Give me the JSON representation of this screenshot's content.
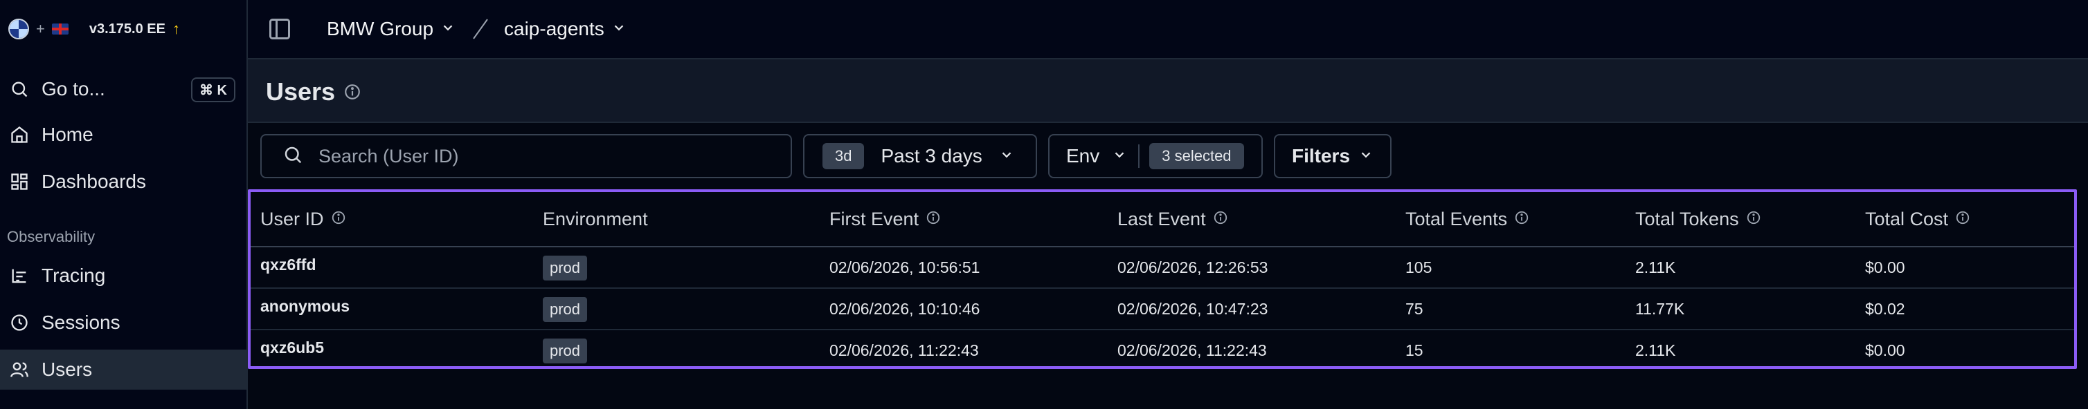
{
  "app": {
    "version": "v3.175.0 EE",
    "plus": "+"
  },
  "sidebar": {
    "goto": {
      "label": "Go to...",
      "shortcut": "⌘ K"
    },
    "items": [
      {
        "label": "Home",
        "icon": "home-icon"
      },
      {
        "label": "Dashboards",
        "icon": "dashboard-icon"
      }
    ],
    "section_label": "Observability",
    "observability_items": [
      {
        "label": "Tracing",
        "icon": "tracing-icon"
      },
      {
        "label": "Sessions",
        "icon": "sessions-icon"
      },
      {
        "label": "Users",
        "icon": "users-icon",
        "active": true
      }
    ]
  },
  "topbar": {
    "organization": "BMW Group",
    "project": "caip-agents"
  },
  "page": {
    "title": "Users"
  },
  "toolbar": {
    "search_placeholder": "Search (User ID)",
    "date_pill": "3d",
    "date_label": "Past 3 days",
    "env_label": "Env",
    "env_selected": "3 selected",
    "filters_label": "Filters"
  },
  "table": {
    "columns": [
      "User ID",
      "Environment",
      "First Event",
      "Last Event",
      "Total Events",
      "Total Tokens",
      "Total Cost"
    ],
    "rows": [
      {
        "user_id": "qxz6ffd",
        "environment": "prod",
        "first_event": "02/06/2026, 10:56:51",
        "last_event": "02/06/2026, 12:26:53",
        "total_events": "105",
        "total_tokens": "2.11K",
        "total_cost": "$0.00"
      },
      {
        "user_id": "anonymous",
        "environment": "prod",
        "first_event": "02/06/2026, 10:10:46",
        "last_event": "02/06/2026, 10:47:23",
        "total_events": "75",
        "total_tokens": "11.77K",
        "total_cost": "$0.02"
      },
      {
        "user_id": "qxz6ub5",
        "environment": "prod",
        "first_event": "02/06/2026, 11:22:43",
        "last_event": "02/06/2026, 11:22:43",
        "total_events": "15",
        "total_tokens": "2.11K",
        "total_cost": "$0.00"
      }
    ]
  },
  "colors": {
    "background": "#030712",
    "sidebar": "#020617",
    "header": "#111827",
    "selection_border": "#8b5cf6",
    "upgrade_arrow": "#facc15"
  }
}
